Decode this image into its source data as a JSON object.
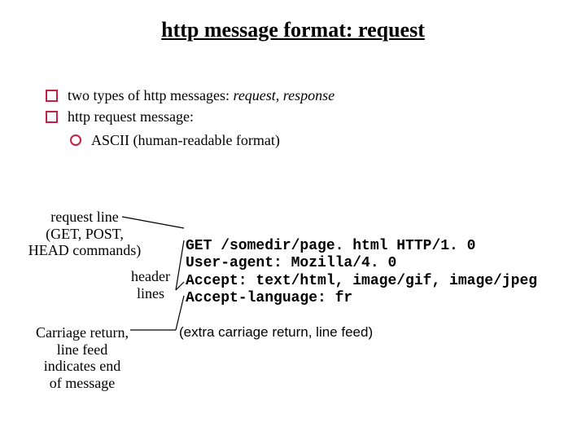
{
  "title": "http message format: request",
  "bullets": {
    "b1_pre": "two types of http messages: ",
    "b1_em": "request, response",
    "b2": "http request message:",
    "sub1": "ASCII (human-readable format)"
  },
  "labels": {
    "request_line": "request line\n(GET, POST,\nHEAD commands)",
    "header_lines": "header\nlines",
    "carriage": "Carriage return,\nline feed\nindicates end\nof message",
    "extra": "(extra carriage return, line feed)"
  },
  "code": {
    "l1": "GET /somedir/page. html HTTP/1. 0",
    "l2": "User-agent: Mozilla/4. 0",
    "l3": "Accept: text/html, image/gif, image/jpeg",
    "l4": "Accept-language: fr"
  }
}
